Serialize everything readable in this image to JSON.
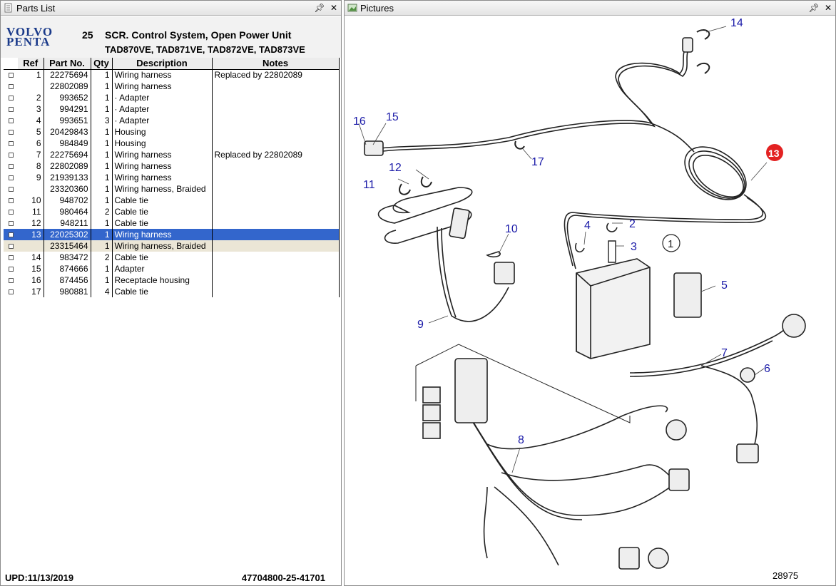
{
  "left_pane": {
    "title": "Parts List",
    "pin_icon": "pin-icon",
    "close_icon": "close-icon"
  },
  "header": {
    "logo_line1": "VOLVO",
    "logo_line2": "PENTA",
    "section_no": "25",
    "section_title": "SCR. Control System, Open Power Unit",
    "models": "TAD870VE, TAD871VE, TAD872VE, TAD873VE"
  },
  "table": {
    "columns": [
      "Ref",
      "Part No.",
      "Qty",
      "Description",
      "Notes"
    ],
    "rows": [
      {
        "ref": "1",
        "part": "22275694",
        "qty": "1",
        "desc": "Wiring harness",
        "notes": "Replaced by 22802089"
      },
      {
        "ref": "",
        "part": "22802089",
        "qty": "1",
        "desc": "Wiring harness",
        "notes": ""
      },
      {
        "ref": "2",
        "part": "993652",
        "qty": "1",
        "desc": "·  Adapter",
        "notes": ""
      },
      {
        "ref": "3",
        "part": "994291",
        "qty": "1",
        "desc": "·  Adapter",
        "notes": ""
      },
      {
        "ref": "4",
        "part": "993651",
        "qty": "3",
        "desc": "·  Adapter",
        "notes": ""
      },
      {
        "ref": "5",
        "part": "20429843",
        "qty": "1",
        "desc": "Housing",
        "notes": ""
      },
      {
        "ref": "6",
        "part": "984849",
        "qty": "1",
        "desc": "Housing",
        "notes": ""
      },
      {
        "ref": "7",
        "part": "22275694",
        "qty": "1",
        "desc": "Wiring harness",
        "notes": "Replaced by 22802089"
      },
      {
        "ref": "8",
        "part": "22802089",
        "qty": "1",
        "desc": "Wiring harness",
        "notes": ""
      },
      {
        "ref": "9",
        "part": "21939133",
        "qty": "1",
        "desc": "Wiring harness",
        "notes": ""
      },
      {
        "ref": "",
        "part": "23320360",
        "qty": "1",
        "desc": "Wiring harness, Braided",
        "notes": ""
      },
      {
        "ref": "10",
        "part": "948702",
        "qty": "1",
        "desc": "Cable tie",
        "notes": ""
      },
      {
        "ref": "11",
        "part": "980464",
        "qty": "2",
        "desc": "Cable tie",
        "notes": ""
      },
      {
        "ref": "12",
        "part": "948211",
        "qty": "1",
        "desc": "Cable tie",
        "notes": ""
      },
      {
        "ref": "13",
        "part": "22025302",
        "qty": "1",
        "desc": "Wiring harness",
        "notes": "",
        "selected": true
      },
      {
        "ref": "",
        "part": "23315464",
        "qty": "1",
        "desc": "Wiring harness, Braided",
        "notes": "",
        "alt": true
      },
      {
        "ref": "14",
        "part": "983472",
        "qty": "2",
        "desc": "Cable tie",
        "notes": ""
      },
      {
        "ref": "15",
        "part": "874666",
        "qty": "1",
        "desc": "Adapter",
        "notes": ""
      },
      {
        "ref": "16",
        "part": "874456",
        "qty": "1",
        "desc": "Receptacle housing",
        "notes": ""
      },
      {
        "ref": "17",
        "part": "980881",
        "qty": "4",
        "desc": "Cable tie",
        "notes": ""
      }
    ]
  },
  "footer": {
    "upd": "UPD:11/13/2019",
    "doc_no": "47704800-25-41701"
  },
  "right_pane": {
    "title": "Pictures",
    "pin_icon": "pin-icon",
    "close_icon": "close-icon"
  },
  "diagram": {
    "drawing_no": "28975",
    "highlighted_ref": "13",
    "circled_note": "1",
    "callouts": [
      "1",
      "2",
      "3",
      "4",
      "5",
      "6",
      "7",
      "8",
      "9",
      "10",
      "11",
      "12",
      "14",
      "15",
      "16",
      "17"
    ],
    "label_color": "#1a1aa8",
    "highlight_color": "#e32222"
  }
}
